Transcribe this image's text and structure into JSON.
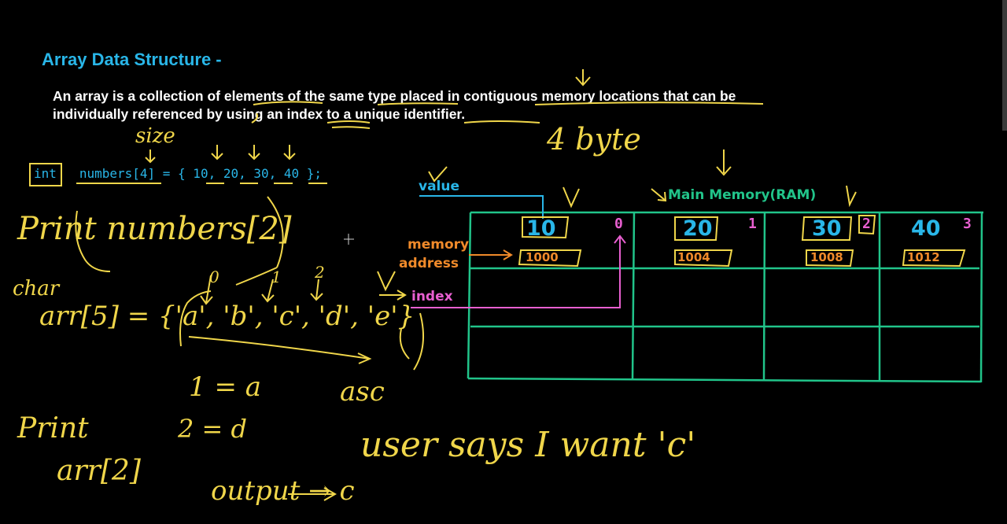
{
  "title": "Array Data Structure -",
  "description": {
    "line1": "An array is a collection of elements of the same type placed in contiguous memory locations that can be",
    "line2": "individually referenced by using an index to a unique identifier."
  },
  "code": {
    "type": "int",
    "declaration": "numbers[4] = { 10, 20, 30, 40 };"
  },
  "labels": {
    "value": "value",
    "memory_address_1": "memory",
    "memory_address_2": "address",
    "index": "index",
    "main_memory": "Main Memory(RAM)"
  },
  "cells": [
    {
      "value": "10",
      "address": "1000",
      "index": "0"
    },
    {
      "value": "20",
      "address": "1004",
      "index": "1"
    },
    {
      "value": "30",
      "address": "1008",
      "index": "2"
    },
    {
      "value": "40",
      "address": "1012",
      "index": "3"
    }
  ],
  "handwriting": {
    "size": "size",
    "four_byte": "4 byte",
    "print_numbers": "Print numbers[2]",
    "char": "char",
    "arr_decl": "arr[5] = {'a', 'b', 'c', 'd', 'e'}",
    "idx0": "0",
    "idx1": "1",
    "idx2": "2",
    "eq1": "1 = a",
    "eq2": "2 = d",
    "asc": "asc",
    "print": "Print",
    "arr2": "arr[2]",
    "output": "output → c",
    "user_says": "user says I want 'c'"
  },
  "colors": {
    "title": "#29b6e8",
    "grid": "#21c48a",
    "annotation": "#f0d64a",
    "value_line": "#29b6e8",
    "address": "#f08a2a",
    "index": "#e85fd0",
    "main_memory": "#21c48a"
  }
}
